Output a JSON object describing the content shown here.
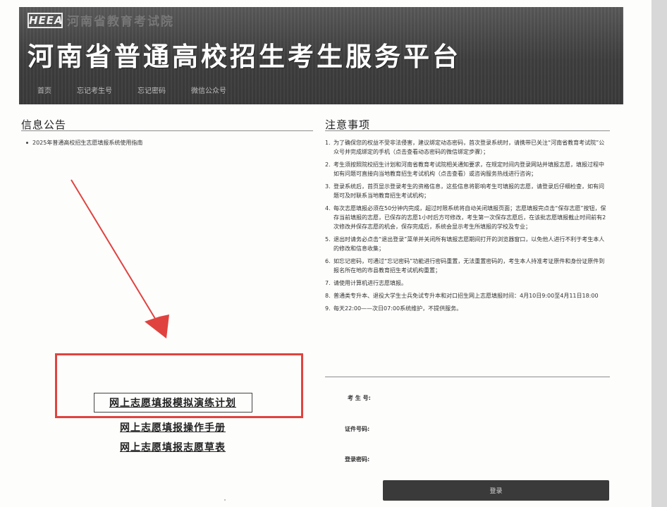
{
  "banner": {
    "logo_text": "HEEA",
    "org_name": "河南省教育考试院",
    "title": "河南省普通高校招生考生服务平台"
  },
  "nav": {
    "items": [
      "首页",
      "忘记考生号",
      "忘记密码",
      "微信公众号"
    ]
  },
  "notice": {
    "title": "信息公告",
    "items": [
      "2025年普通高校招生志愿填报系统使用指南"
    ]
  },
  "links": {
    "simulation": "网上志愿填报模拟演练计划",
    "manual": "网上志愿填报操作手册",
    "draft": "网上志愿填报志愿草表"
  },
  "rules": {
    "title": "注意事项",
    "items": [
      {
        "no": "1.",
        "text": "为了确保您的权益不受非法侵害，建议绑定动态密码，首次登录系统时，请携带已关注“河南省教育考试院”公众号并完成绑定的手机（点击查看动态密码的微信绑定步骤）；"
      },
      {
        "no": "2.",
        "text": "考生须按照院校招生计划和河南省教育考试院相关通知要求，在规定时间内登录网站并填报志愿，填报过程中如有问题可直接向当地教育招生考试机构（点击查看）或咨询服务热线进行咨询；"
      },
      {
        "no": "3.",
        "text": "登录系统后，首页显示登录考生的资格信息，这些信息将影响考生可填报的志愿，请登录后仔细检查，如有问题可及时联系当地教育招生考试机构；"
      },
      {
        "no": "4.",
        "text": "每次志愿填报必须在50分钟内完成，超过时限系统将自动关闭填报页面；志愿填报完点击“保存志愿”按钮，保存当前填报的志愿，已保存的志愿1小时后方可修改，考生第一次保存志愿后，在该批志愿填报截止时间前有2次修改并保存志愿的机会，保存完成后，系统会显示考生所填报的学校及专业；"
      },
      {
        "no": "5.",
        "text": "退出时请务必点击“退出登录”菜单并关闭所有填报志愿期间打开的浏览器窗口，以免他人进行不利于考生本人的修改和信息收集；"
      },
      {
        "no": "6.",
        "text": "如忘记密码，可通过“忘记密码”功能进行密码重置，无法重置密码的，考生本人持准考证原件和身份证原件到报名所在地的市县教育招生考试机构重置；"
      },
      {
        "no": "7.",
        "text": "请使用计算机进行志愿填报。"
      },
      {
        "no": "8.",
        "text": "普通类专升本、退役大学生士兵免试专升本和对口招生网上志愿填报时间：4月10日9:00至4月11日18:00"
      },
      {
        "no": "9.",
        "text": "每天22:00——次日07:00系统维护，不提供服务。"
      }
    ]
  },
  "login": {
    "student_no_label": "考 生 号:",
    "id_label": "证件号码:",
    "password_label": "登录密码:",
    "button": "登录"
  },
  "colors": {
    "banner": "#3e3e3e",
    "highlight": "#e0433f",
    "button": "#3a3a3a"
  }
}
